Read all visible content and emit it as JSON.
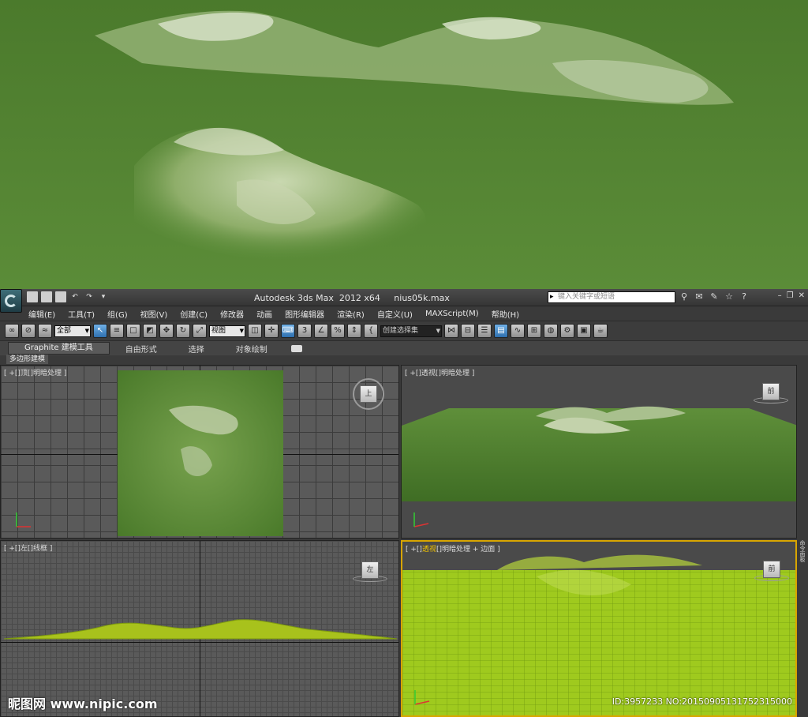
{
  "app": {
    "title": "Autodesk 3ds Max  2012 x64     nius05k.max",
    "search_placeholder": "键入关键字或短语"
  },
  "menu": [
    "编辑(E)",
    "工具(T)",
    "组(G)",
    "视图(V)",
    "创建(C)",
    "修改器",
    "动画",
    "图形编辑器",
    "渲染(R)",
    "自定义(U)",
    "MAXScript(M)",
    "帮助(H)"
  ],
  "toolbar": {
    "filter": "全部",
    "coord": "视图",
    "selset": "创建选择集"
  },
  "ribbon": {
    "tabs": [
      "Graphite 建模工具",
      "自由形式",
      "选择",
      "对象绘制"
    ],
    "sub": "多边形建模"
  },
  "viewports": {
    "top": {
      "label": "[ +[]顶[]明暗处理 ]",
      "cube": "上"
    },
    "persp": {
      "label": "[ +[]透视[]明暗处理 ]",
      "cube": "前"
    },
    "left": {
      "label": "[ +[]左[]线框 ]",
      "cube": "左"
    },
    "persp2": {
      "label_pre": "[ +[]",
      "label_hl": "透视",
      "label_post": "[]明暗处理 + 边面 ]",
      "cube": "前"
    }
  },
  "command_panel": "命令面板",
  "watermark": "昵图网 www.nipic.com",
  "image_id": "ID:3957233 NO:20150905131752315000",
  "colors": {
    "terrain": "#5f8f3a",
    "wire": "#a8d020",
    "selected_border": "#d8a500"
  }
}
